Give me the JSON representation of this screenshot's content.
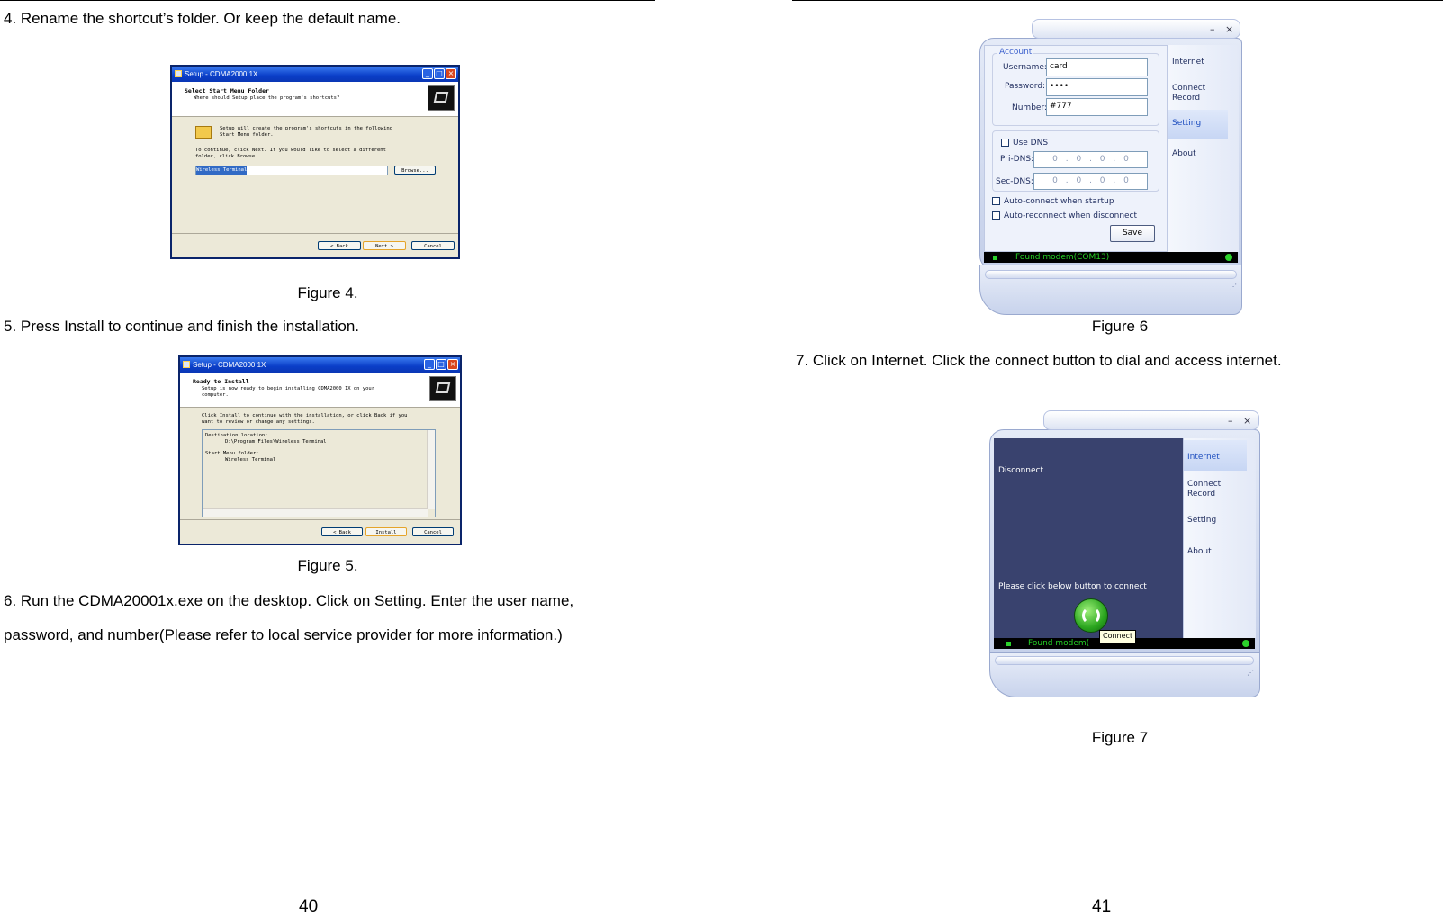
{
  "left_page": {
    "step4": "4. Rename the shortcut’s folder. Or keep the default name.",
    "figure4_caption": "Figure 4.",
    "step5": "5. Press Install to continue and finish the installation.",
    "figure5_caption": "Figure 5.",
    "step6_line1": "6. Run the CDMA20001x.exe on the desktop. Click on Setting. Enter the user name,",
    "step6_line2": "password, and number(Please refer to local service provider for more information.)",
    "page_number": "40"
  },
  "right_page": {
    "figure6_caption": "Figure 6",
    "step7": "7. Click on Internet. Click the connect button to dial and access internet.",
    "figure7_caption": "Figure 7",
    "page_number": "41"
  },
  "figure4": {
    "title": "Setup - CDMA2000 1X",
    "heading": "Select Start Menu Folder",
    "subheading": "Where should Setup place the program's shortcuts?",
    "info_line1": "Setup will create the program's shortcuts in the following",
    "info_line2": "Start Menu folder.",
    "instr_line1": "To continue, click Next. If you would like to select a different",
    "instr_line2": "folder, click Browse.",
    "folder_value": "Wireless Terminal",
    "browse": "Browse...",
    "back": "< Back",
    "next": "Next >",
    "cancel": "Cancel"
  },
  "figure5": {
    "title": "Setup - CDMA2000 1X",
    "heading": "Ready to Install",
    "subheading_line1": "Setup is now ready to begin installing CDMA2000 1X on your",
    "subheading_line2": "computer.",
    "instr_line1": "Click Install to continue with the installation, or click Back if you",
    "instr_line2": "want to review or change any settings.",
    "dest_label": "Destination location:",
    "dest_value": "D:\\Program Files\\Wireless Terminal",
    "menu_label": "Start Menu folder:",
    "menu_value": "Wireless Terminal",
    "back": "< Back",
    "install": "Install",
    "cancel": "Cancel"
  },
  "figure6": {
    "account_legend": "Account",
    "username_label": "Username:",
    "username_value": "card",
    "password_label": "Password:",
    "password_value": "••••",
    "number_label": "Number:",
    "number_value": "#777",
    "use_dns": "Use DNS",
    "pri_dns_label": "Pri-DNS:",
    "sec_dns_label": "Sec-DNS:",
    "dns_value": "0 . 0 . 0 . 0",
    "auto_connect": "Auto-connect when startup",
    "auto_reconnect": "Auto-reconnect when disconnect",
    "save": "Save",
    "status": "Found modem(COM13)",
    "nav": {
      "internet": "Internet",
      "connect_record_1": "Connect",
      "connect_record_2": "Record",
      "setting": "Setting",
      "about": "About"
    },
    "minimize": "–",
    "close": "×"
  },
  "figure7": {
    "disconnect": "Disconnect",
    "prompt": "Please click below button to connect",
    "tooltip": "Connect",
    "status": "Found modem(",
    "nav": {
      "internet": "Internet",
      "connect_record_1": "Connect",
      "connect_record_2": "Record",
      "setting": "Setting",
      "about": "About"
    },
    "minimize": "–",
    "close": "×"
  }
}
